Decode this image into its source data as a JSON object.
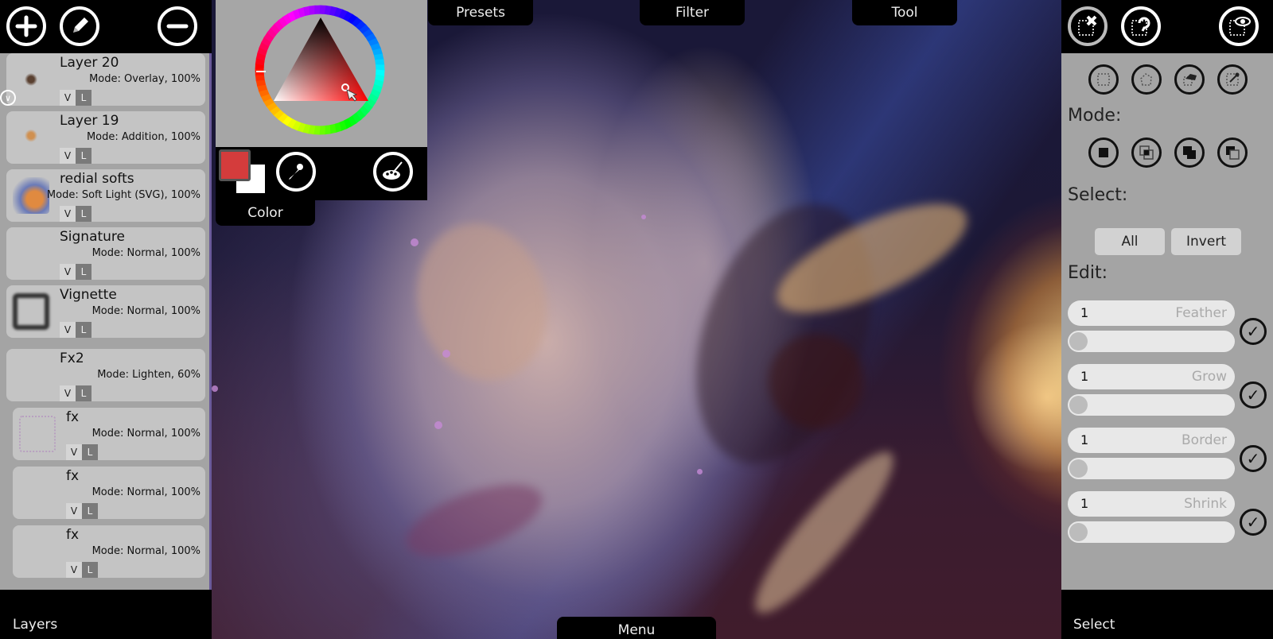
{
  "top_tabs": {
    "presets": "Presets",
    "filter": "Filter",
    "tool": "Tool"
  },
  "bottom_tab": {
    "menu": "Menu"
  },
  "layers_panel": {
    "title": "Layers",
    "toolbar": [
      "add-layer",
      "edit-layer",
      "remove-layer"
    ],
    "items": [
      {
        "name": "Layer 20",
        "mode": "Mode: Overlay, 100%",
        "v": "V",
        "l": "L"
      },
      {
        "name": "Layer 19",
        "mode": "Mode: Addition, 100%",
        "v": "V",
        "l": "L"
      },
      {
        "name": "redial softs",
        "mode": "Mode: Soft Light (SVG), 100%",
        "v": "V",
        "l": "L"
      },
      {
        "name": "Signature",
        "mode": "Mode: Normal, 100%",
        "v": "V",
        "l": "L"
      },
      {
        "name": "Vignette",
        "mode": "Mode: Normal, 100%",
        "v": "V",
        "l": "L"
      },
      {
        "name": "Fx2",
        "mode": "Mode: Lighten, 60%",
        "v": "V",
        "l": "L"
      },
      {
        "name": "fx",
        "mode": "Mode: Normal, 100%",
        "v": "V",
        "l": "L"
      },
      {
        "name": "fx",
        "mode": "Mode: Normal, 100%",
        "v": "V",
        "l": "L"
      },
      {
        "name": "fx",
        "mode": "Mode: Normal, 100%",
        "v": "V",
        "l": "L"
      }
    ]
  },
  "color_panel": {
    "title": "Color",
    "primary_color": "#d43c3c",
    "secondary_color": "#ffffff",
    "hue_color": "#ff0000"
  },
  "select_panel": {
    "title": "Select",
    "mode_label": "Mode:",
    "select_label": "Select:",
    "edit_label": "Edit:",
    "all_button": "All",
    "invert_button": "Invert",
    "edit_fields": [
      {
        "value": "1",
        "placeholder": "Feather"
      },
      {
        "value": "1",
        "placeholder": "Grow"
      },
      {
        "value": "1",
        "placeholder": "Border"
      },
      {
        "value": "1",
        "placeholder": "Shrink"
      }
    ],
    "check_glyph": "✓"
  }
}
